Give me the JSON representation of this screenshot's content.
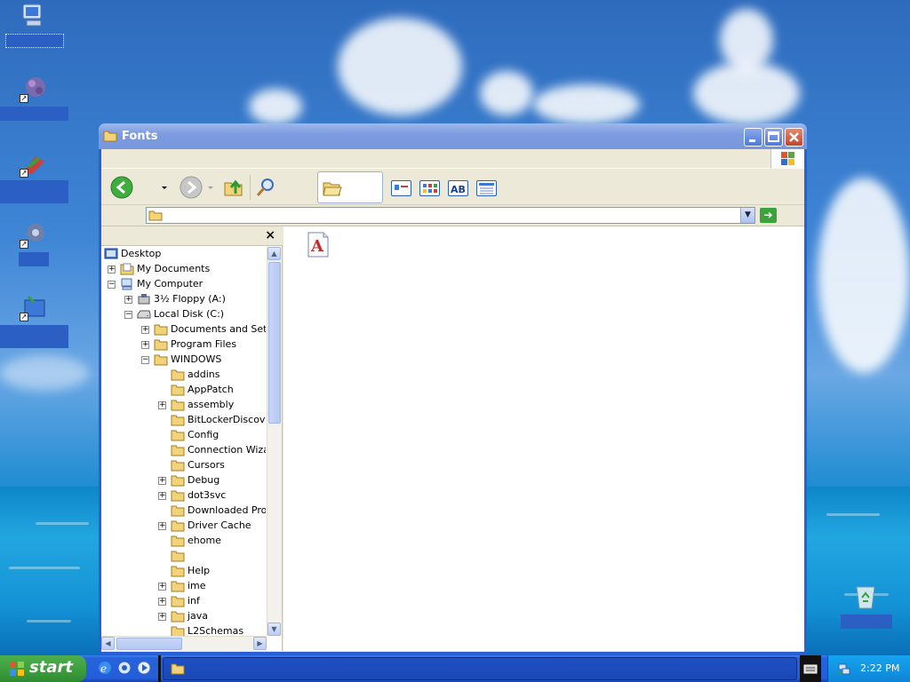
{
  "window": {
    "title": "Fonts",
    "address_value": "",
    "folders_pane_close": "×"
  },
  "tree": [
    {
      "label": "Desktop",
      "expander": ""
    },
    {
      "label": "My Documents",
      "expander": "+"
    },
    {
      "label": "My Computer",
      "expander": "−"
    },
    {
      "label": "3½ Floppy (A:)",
      "expander": "+"
    },
    {
      "label": "Local Disk (C:)",
      "expander": "−"
    },
    {
      "label": "Documents and Settir",
      "expander": "+"
    },
    {
      "label": "Program Files",
      "expander": "+"
    },
    {
      "label": "WINDOWS",
      "expander": "−"
    },
    {
      "label": "addins",
      "expander": ""
    },
    {
      "label": "AppPatch",
      "expander": ""
    },
    {
      "label": "assembly",
      "expander": "+"
    },
    {
      "label": "BitLockerDiscover",
      "expander": ""
    },
    {
      "label": "Config",
      "expander": ""
    },
    {
      "label": "Connection Wizar",
      "expander": ""
    },
    {
      "label": "Cursors",
      "expander": ""
    },
    {
      "label": "Debug",
      "expander": "+"
    },
    {
      "label": "dot3svc",
      "expander": "+"
    },
    {
      "label": "Downloaded Prog",
      "expander": ""
    },
    {
      "label": "Driver Cache",
      "expander": "+"
    },
    {
      "label": "ehome",
      "expander": ""
    },
    {
      "label": "",
      "expander": ""
    },
    {
      "label": "Help",
      "expander": ""
    },
    {
      "label": "ime",
      "expander": "+"
    },
    {
      "label": "inf",
      "expander": "+"
    },
    {
      "label": "java",
      "expander": "+"
    },
    {
      "label": "L2Schemas",
      "expander": ""
    }
  ],
  "taskbar": {
    "start_label": "start",
    "clock": "2:22 PM"
  },
  "colors": {
    "title_bar": "#7d9be0",
    "taskbar": "#245edb",
    "start_button": "#3c9d3c"
  }
}
